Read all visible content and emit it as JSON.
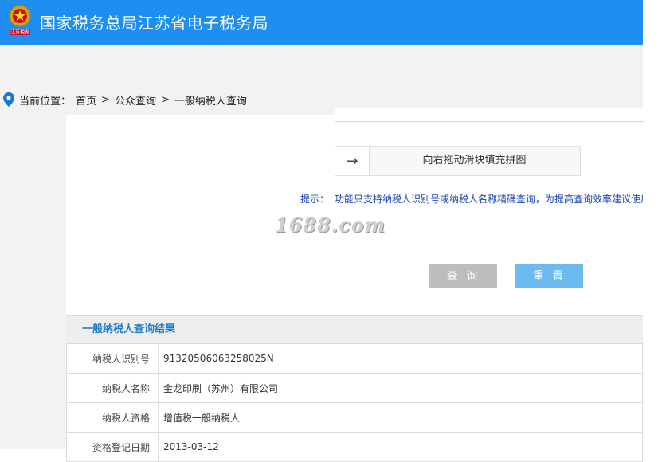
{
  "header": {
    "title": "国家税务总局江苏省电子税务局",
    "emblem_icon": "tax-emblem-icon",
    "emblem_caption": "江苏税务",
    "background_color": "#1e8ef1"
  },
  "breadcrumb": {
    "location_icon": "map-pin-icon",
    "prefix": "当前位置：",
    "separator": ">",
    "items": [
      "首页",
      "公众查询",
      "一般纳税人查询"
    ]
  },
  "slider": {
    "handle_icon": "arrow-right-icon",
    "handle_glyph": "→",
    "text": "向右拖动滑块填充拼图"
  },
  "tip": {
    "label": "提示：",
    "text": "功能只支持纳税人识别号或纳税人名称精确查询，为提高查询效率建议使用"
  },
  "watermark": "1688.com",
  "buttons": {
    "query": "查 询",
    "reset": "重 置",
    "query_color": "#bdbdbd",
    "reset_color": "#6cbaf0"
  },
  "result": {
    "title": "一般纳税人查询结果",
    "rows": [
      {
        "key": "纳税人识别号",
        "value": "91320506063258025N"
      },
      {
        "key": "纳税人名称",
        "value": "金龙印刷（苏州）有限公司"
      },
      {
        "key": "纳税人资格",
        "value": "增值税一般纳税人"
      },
      {
        "key": "资格登记日期",
        "value": "2013-03-12"
      }
    ]
  }
}
